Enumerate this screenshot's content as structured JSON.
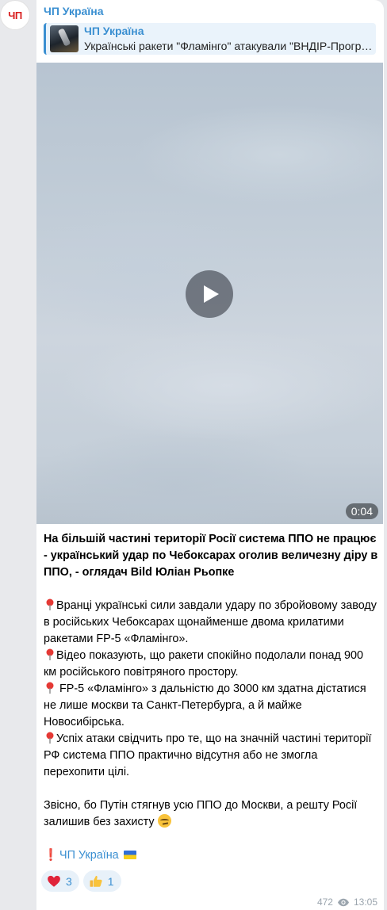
{
  "channel": {
    "avatar_text": "ЧП",
    "name": "ЧП Україна"
  },
  "reply": {
    "title": "ЧП Україна",
    "text": "Українські ракети \"Фламінго\" атакували \"ВНДІР-Прогр…"
  },
  "video": {
    "duration": "0:04"
  },
  "message": {
    "headline": "На більшій частині території Росії система ППО не працює - український удар по Чебоксарах оголив величезну діру в ППО, - оглядач Bild Юліан Рьопке",
    "bullets": [
      "Вранці українські сили завдали удару по збройовому заводу в російських Чебоксарах щонайменше двома крилатими ракетами FP-5 «Фламінго».",
      "Відео показують, що ракети спокійно подолали понад 900 км російського повітряного простору.",
      " FP-5 «Фламінго» з дальністю до 3000 км здатна дістатися не лише москви та Санкт-Петербурга, а й майже Новосибірська.",
      "Успіх атаки свідчить про те, що на значній частині території РФ система ППО практично відсутня або не змогла перехопити цілі."
    ],
    "conclusion": "Звісно, бо Путін стягнув усю ППО до Москви, а решту Росії залишив без захисту",
    "signature": "ЧП Україна"
  },
  "reactions": [
    {
      "emoji": "heart",
      "count": "3"
    },
    {
      "emoji": "thumbs-up",
      "count": "1"
    }
  ],
  "meta": {
    "views": "472",
    "time": "13:05"
  },
  "colors": {
    "accent": "#3a8fd1",
    "avatar_red": "#d81e1e",
    "reply_bg": "#eaf3fb",
    "reaction_bg": "#e8f1f9",
    "chat_bg": "#e8e9ec"
  }
}
